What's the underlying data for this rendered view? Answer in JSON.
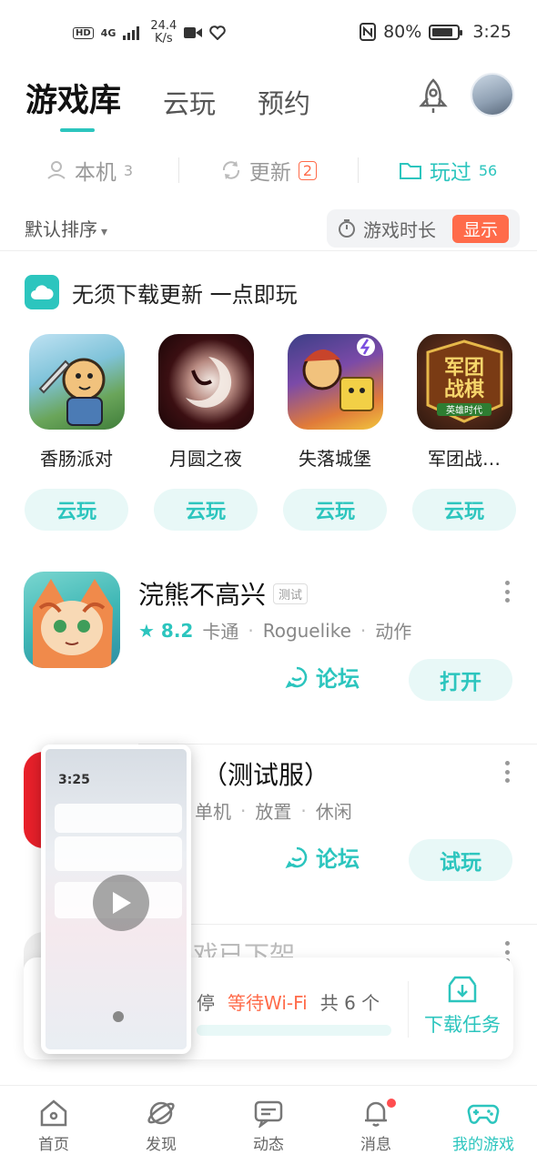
{
  "status_bar": {
    "hd": "HD",
    "network": "4G",
    "speed_value": "24.4",
    "speed_unit": "K/s",
    "battery": "80%",
    "time": "3:25"
  },
  "top_tabs": [
    {
      "label": "游戏库",
      "active": true
    },
    {
      "label": "云玩",
      "active": false
    },
    {
      "label": "预约",
      "active": false
    }
  ],
  "filters": {
    "local": {
      "label": "本机",
      "count": "3"
    },
    "update": {
      "label": "更新",
      "count": "2"
    },
    "played": {
      "label": "玩过",
      "count": "56"
    }
  },
  "sort": {
    "label": "默认排序",
    "time_label": "游戏时长",
    "show_label": "显示"
  },
  "cloud_section": {
    "title": "无须下载更新 一点即玩",
    "button_label": "云玩",
    "games": [
      {
        "name": "香肠派对"
      },
      {
        "name": "月圆之夜"
      },
      {
        "name": "失落城堡"
      },
      {
        "name": "军团战…",
        "icon_text_1": "军团",
        "icon_text_2": "战棋",
        "icon_text_3": "英雄时代"
      }
    ]
  },
  "games": [
    {
      "title": "浣熊不高兴",
      "tag": "测试",
      "rating": "8.2",
      "genres": [
        "卡通",
        "Roguelike",
        "动作"
      ],
      "forum_label": "论坛",
      "action_label": "打开"
    },
    {
      "title": "（测试服）",
      "genres": [
        "单机",
        "放置",
        "休闲"
      ],
      "forum_label": "论坛",
      "action_label": "试玩"
    },
    {
      "title": "戏已下架"
    }
  ],
  "download_bar": {
    "status": "停",
    "wifi_label": "等待Wi-Fi",
    "total_label": "共 6 个",
    "task_label": "下载任务"
  },
  "pip_preview": {
    "time": "3:25"
  },
  "bottom_nav": [
    {
      "label": "首页",
      "icon": "home-icon"
    },
    {
      "label": "发现",
      "icon": "planet-icon"
    },
    {
      "label": "动态",
      "icon": "chat-icon"
    },
    {
      "label": "消息",
      "icon": "bell-icon"
    },
    {
      "label": "我的游戏",
      "icon": "gamepad-icon",
      "active": true
    }
  ],
  "colors": {
    "accent": "#2cc5be",
    "warning": "#ff6b4a"
  }
}
